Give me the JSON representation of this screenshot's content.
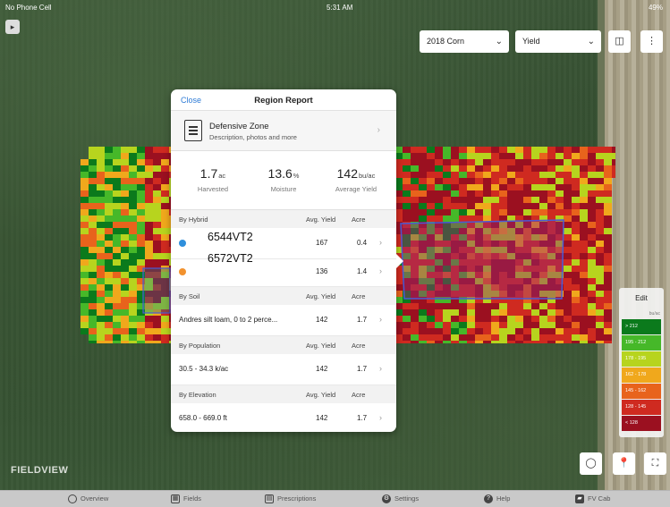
{
  "status_bar": {
    "carrier": "No Phone Cell",
    "time": "5:31 AM",
    "battery": "49%"
  },
  "toolbar": {
    "season": "2018 Corn",
    "layer": "Yield",
    "sidebar_toggle_icon": "sidebar-toggle-icon",
    "split_view_icon": "split-view-icon",
    "more_icon": "more-icon"
  },
  "report": {
    "close_label": "Close",
    "title": "Region Report",
    "zone": {
      "title": "Defensive Zone",
      "subtitle": "Description, photos and more",
      "icon": "notepad-icon"
    },
    "stats": [
      {
        "value": "1.7",
        "unit": "ac",
        "label": "Harvested"
      },
      {
        "value": "13.6",
        "unit": "%",
        "label": "Moisture"
      },
      {
        "value": "142",
        "unit": "bu/ac",
        "label": "Average Yield"
      }
    ],
    "column_avg_yield": "Avg. Yield",
    "column_acre": "Acre",
    "sections": {
      "hybrid": {
        "title": "By Hybrid",
        "rows": [
          {
            "name": "6544VT2",
            "avg_yield": "167",
            "acre": "0.4",
            "color": "#2f8fdc"
          },
          {
            "name": "6572VT2",
            "avg_yield": "136",
            "acre": "1.4",
            "color": "#f2922e"
          }
        ]
      },
      "soil": {
        "title": "By Soil",
        "rows": [
          {
            "name": "Andres silt loam, 0 to 2 perce...",
            "avg_yield": "142",
            "acre": "1.7"
          }
        ]
      },
      "population": {
        "title": "By Population",
        "rows": [
          {
            "name": "30.5 - 34.3 k/ac",
            "avg_yield": "142",
            "acre": "1.7"
          }
        ]
      },
      "elevation": {
        "title": "By Elevation",
        "rows": [
          {
            "name": "658.0 - 669.0 ft",
            "avg_yield": "142",
            "acre": "1.7"
          }
        ]
      }
    }
  },
  "legend": {
    "edit_label": "Edit",
    "unit": "bu/ac",
    "items": [
      {
        "label": "> 212",
        "color": "#0b7a1c"
      },
      {
        "label": "195 - 212",
        "color": "#46b829"
      },
      {
        "label": "178 - 195",
        "color": "#b7d41e"
      },
      {
        "label": "162 - 178",
        "color": "#f0a81c"
      },
      {
        "label": "145 - 162",
        "color": "#e8631c"
      },
      {
        "label": "128 - 145",
        "color": "#cf2a20"
      },
      {
        "label": "< 128",
        "color": "#9b1020"
      }
    ]
  },
  "logo_text": "FIELDVIEW",
  "map_buttons": {
    "lasso_icon": "lasso-icon",
    "pin_icon": "pin-icon",
    "fullscreen_icon": "fullscreen-icon"
  },
  "tabs": [
    {
      "label": "Overview",
      "icon": "overview-icon"
    },
    {
      "label": "Fields",
      "icon": "fields-icon"
    },
    {
      "label": "Prescriptions",
      "icon": "prescriptions-icon"
    },
    {
      "label": "Settings",
      "icon": "gear-icon"
    },
    {
      "label": "Help",
      "icon": "help-icon"
    },
    {
      "label": "FV Cab",
      "icon": "tractor-icon"
    }
  ]
}
